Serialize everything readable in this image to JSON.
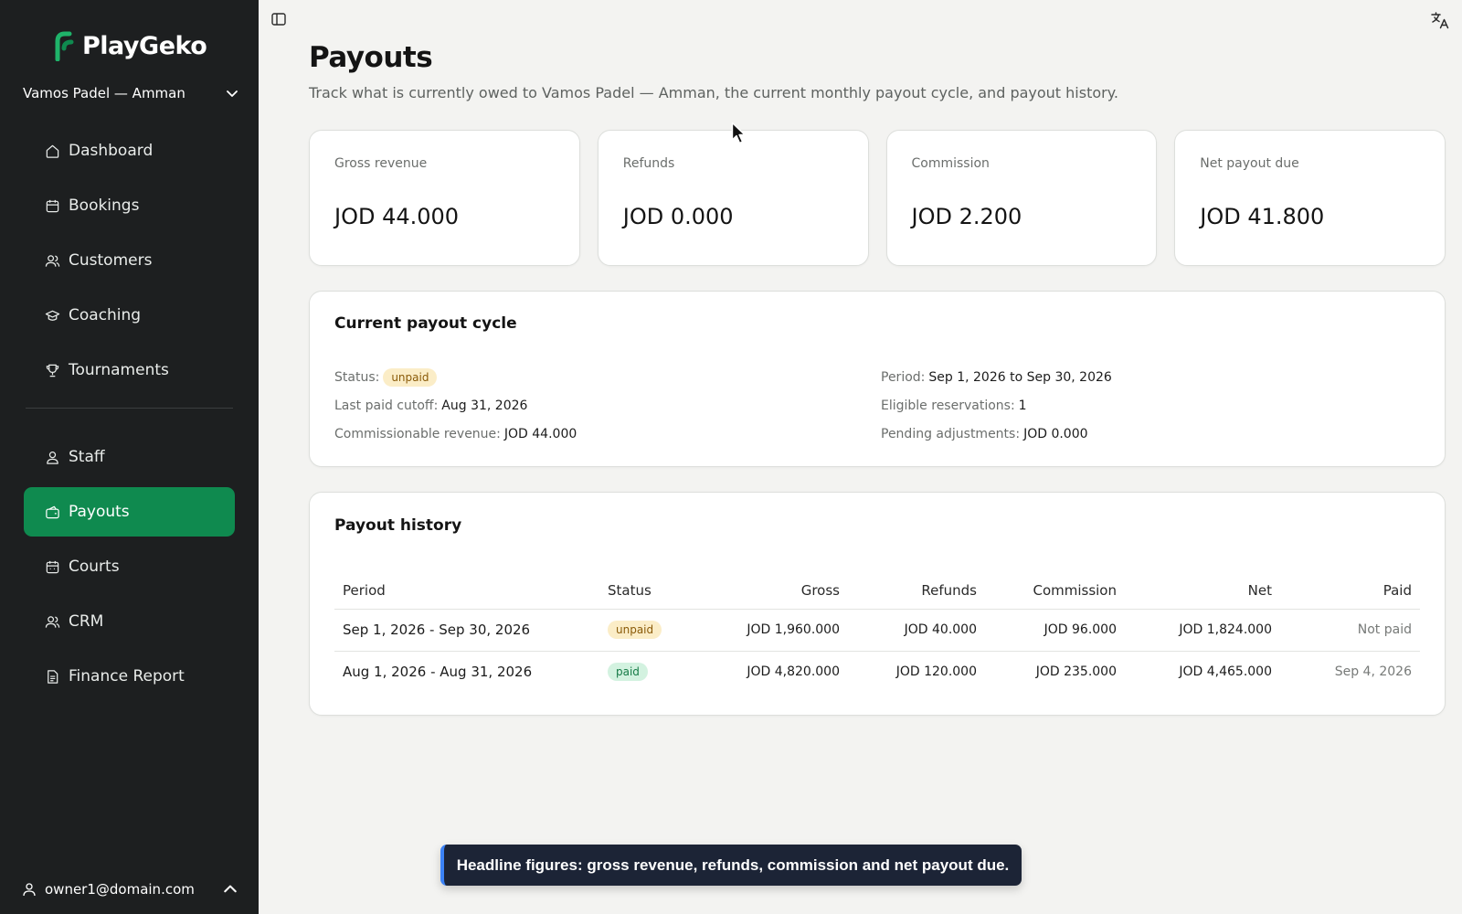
{
  "app": {
    "brand": "PlayGeko",
    "venue_selector": "Vamos Padel — Amman",
    "accent_color": "#0f8a4f"
  },
  "sidebar": {
    "items": [
      {
        "label": "Dashboard",
        "icon": "home-icon"
      },
      {
        "label": "Bookings",
        "icon": "calendar-icon"
      },
      {
        "label": "Customers",
        "icon": "users-icon"
      },
      {
        "label": "Coaching",
        "icon": "graduation-cap-icon"
      },
      {
        "label": "Tournaments",
        "icon": "trophy-icon"
      },
      {
        "label": "Staff",
        "icon": "user-icon"
      },
      {
        "label": "Payouts",
        "icon": "wallet-icon",
        "active": true
      },
      {
        "label": "Courts",
        "icon": "calendar-grid-icon"
      },
      {
        "label": "CRM",
        "icon": "users-icon"
      },
      {
        "label": "Finance Report",
        "icon": "document-icon"
      }
    ],
    "user_email": "owner1@domain.com"
  },
  "page": {
    "title": "Payouts",
    "subtitle": "Track what is currently owed to Vamos Padel — Amman, the current monthly payout cycle, and payout history."
  },
  "summary_cards": [
    {
      "label": "Gross revenue",
      "value": "JOD 44.000"
    },
    {
      "label": "Refunds",
      "value": "JOD 0.000"
    },
    {
      "label": "Commission",
      "value": "JOD 2.200"
    },
    {
      "label": "Net payout due",
      "value": "JOD 41.800"
    }
  ],
  "current_cycle": {
    "title": "Current payout cycle",
    "status_label": "Status:",
    "status_value": "unpaid",
    "last_paid_label": "Last paid cutoff:",
    "last_paid_value": "Aug 31, 2026",
    "commissionable_label": "Commissionable revenue:",
    "commissionable_value": "JOD 44.000",
    "period_label": "Period:",
    "period_value": "Sep 1, 2026 to Sep 30, 2026",
    "eligible_label": "Eligible reservations:",
    "eligible_value": "1",
    "pending_label": "Pending adjustments:",
    "pending_value": "JOD 0.000"
  },
  "history": {
    "title": "Payout history",
    "columns": [
      "Period",
      "Status",
      "Gross",
      "Refunds",
      "Commission",
      "Net",
      "Paid"
    ],
    "rows": [
      {
        "period": "Sep 1, 2026 - Sep 30, 2026",
        "status": "unpaid",
        "gross": "JOD 1,960.000",
        "refunds": "JOD 40.000",
        "commission": "JOD 96.000",
        "net": "JOD 1,824.000",
        "paid": "Not paid"
      },
      {
        "period": "Aug 1, 2026 - Aug 31, 2026",
        "status": "paid",
        "gross": "JOD 4,820.000",
        "refunds": "JOD 120.000",
        "commission": "JOD 235.000",
        "net": "JOD 4,465.000",
        "paid": "Sep 4, 2026"
      }
    ]
  },
  "toast": {
    "text": "Headline figures: gross revenue, refunds, commission and net payout due."
  }
}
